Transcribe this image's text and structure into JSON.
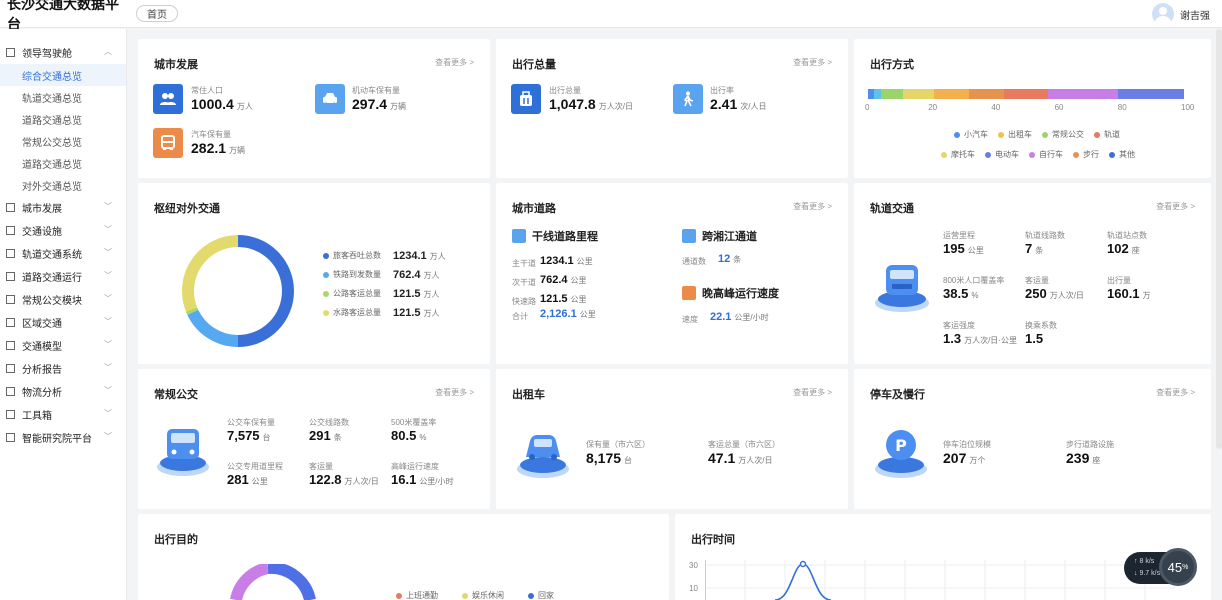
{
  "app": {
    "title": "长沙交通大数据平台",
    "tab": "首页",
    "user": "谢吉强"
  },
  "sidebar": {
    "groups": [
      {
        "label": "领导驾驶舱",
        "expanded": true,
        "items": [
          "综合交通总览",
          "轨道交通总览",
          "道路交通总览",
          "常规公交总览",
          "道路交通总览",
          "对外交通总览"
        ]
      },
      {
        "label": "城市发展"
      },
      {
        "label": "交通设施"
      },
      {
        "label": "轨道交通系统"
      },
      {
        "label": "道路交通运行"
      },
      {
        "label": "常规公交模块"
      },
      {
        "label": "区域交通"
      },
      {
        "label": "交通模型"
      },
      {
        "label": "分析报告"
      },
      {
        "label": "物流分析"
      },
      {
        "label": "工具箱"
      },
      {
        "label": "智能研究院平台"
      }
    ],
    "active_item": "综合交通总览"
  },
  "common": {
    "more": "查看更多 >"
  },
  "city": {
    "title": "城市发展",
    "items": [
      {
        "label": "常住人口",
        "value": "1000.4",
        "unit": "万人",
        "icon": "people-icon"
      },
      {
        "label": "机动车保有量",
        "value": "297.4",
        "unit": "万辆",
        "icon": "car-icon"
      },
      {
        "label": "汽车保有量",
        "value": "282.1",
        "unit": "万辆",
        "icon": "bus-icon"
      }
    ]
  },
  "trips": {
    "title": "出行总量",
    "items": [
      {
        "label": "出行总量",
        "value": "1,047.8",
        "unit": "万人次/日",
        "icon": "bag-icon"
      },
      {
        "label": "出行率",
        "value": "2.41",
        "unit": "次/人日",
        "icon": "walk-icon"
      }
    ]
  },
  "mode": {
    "title": "出行方式",
    "ticks": [
      "0",
      "20",
      "40",
      "60",
      "80",
      "100"
    ],
    "legend_row1": [
      {
        "label": "小汽车",
        "color": "#4f8df2"
      },
      {
        "label": "出租车",
        "color": "#f2c14f"
      },
      {
        "label": "常规公交",
        "color": "#9bd46b"
      },
      {
        "label": "轨道",
        "color": "#e87a5d"
      }
    ],
    "legend_row2": [
      {
        "label": "摩托车",
        "color": "#e6d66a"
      },
      {
        "label": "电动车",
        "color": "#6a7fe6"
      },
      {
        "label": "自行车",
        "color": "#c77ee6"
      },
      {
        "label": "步行",
        "color": "#e6934f"
      },
      {
        "label": "其他",
        "color": "#3b6fd8"
      }
    ],
    "segments": [
      {
        "value": 2,
        "color": "#4f8df2"
      },
      {
        "value": 2,
        "color": "#5ec2e8"
      },
      {
        "value": 7,
        "color": "#9bd46b"
      },
      {
        "value": 10,
        "color": "#e6d66a"
      },
      {
        "value": 11,
        "color": "#f2b04f"
      },
      {
        "value": 11,
        "color": "#e6934f"
      },
      {
        "value": 14,
        "color": "#e87a5d"
      },
      {
        "value": 22,
        "color": "#c77ee6"
      },
      {
        "value": 21,
        "color": "#6a7fe6"
      }
    ]
  },
  "hub": {
    "title": "枢纽对外交通",
    "items": [
      {
        "label": "旅客吞吐总数",
        "value": "1234.1",
        "unit": "万人",
        "color": "#3b6fd8",
        "share": 0.5
      },
      {
        "label": "铁路到发数量",
        "value": "762.4",
        "unit": "万人",
        "color": "#56a8f0",
        "share": 0.18
      },
      {
        "label": "公路客运总量",
        "value": "121.5",
        "unit": "万人",
        "color": "#a9d86a",
        "share": 0.01
      },
      {
        "label": "水路客运总量",
        "value": "121.5",
        "unit": "万人",
        "color": "#e3da6e",
        "share": 0.31
      }
    ]
  },
  "road": {
    "title": "城市道路",
    "mileage": {
      "title": "干线道路里程",
      "rows": [
        {
          "label": "主干道",
          "value": "1234.1",
          "unit": "公里"
        },
        {
          "label": "次干道",
          "value": "762.4",
          "unit": "公里"
        },
        {
          "label": "快速路",
          "value": "121.5",
          "unit": "公里"
        }
      ],
      "total_label": "合计",
      "total_value": "2,126.1",
      "total_unit": "公里"
    },
    "river": {
      "title": "跨湘江通道",
      "label": "通道数",
      "value": "12",
      "unit": "条"
    },
    "peak": {
      "title": "晚高峰运行速度",
      "label": "速度",
      "value": "22.1",
      "unit": "公里/小时"
    }
  },
  "rail": {
    "title": "轨道交通",
    "items": [
      {
        "label": "运营里程",
        "value": "195",
        "unit": "公里"
      },
      {
        "label": "轨道线路数",
        "value": "7",
        "unit": "条"
      },
      {
        "label": "轨道站点数",
        "value": "102",
        "unit": "座"
      },
      {
        "label": "800米人口覆盖率",
        "value": "38.5",
        "unit": "%"
      },
      {
        "label": "客运量",
        "value": "250",
        "unit": "万人次/日"
      },
      {
        "label": "出行量",
        "value": "160.1",
        "unit": "万"
      },
      {
        "label": "客运强度",
        "value": "1.3",
        "unit": "万人次/日·公里"
      },
      {
        "label": "换乘系数",
        "value": "1.5",
        "unit": ""
      }
    ]
  },
  "bus": {
    "title": "常规公交",
    "items": [
      {
        "label": "公交车保有量",
        "value": "7,575",
        "unit": "台"
      },
      {
        "label": "公交线路数",
        "value": "291",
        "unit": "条"
      },
      {
        "label": "500米覆盖率",
        "value": "80.5",
        "unit": "%"
      },
      {
        "label": "公交专用道里程",
        "value": "281",
        "unit": "公里"
      },
      {
        "label": "客运量",
        "value": "122.8",
        "unit": "万人次/日"
      },
      {
        "label": "高峰运行速度",
        "value": "16.1",
        "unit": "公里/小时"
      }
    ]
  },
  "taxi": {
    "title": "出租车",
    "items": [
      {
        "label": "保有量（市六区）",
        "value": "8,175",
        "unit": "台"
      },
      {
        "label": "客运总量（市六区）",
        "value": "47.1",
        "unit": "万人次/日"
      }
    ]
  },
  "parking": {
    "title": "停车及慢行",
    "items": [
      {
        "label": "停车泊位规模",
        "value": "207",
        "unit": "万个"
      },
      {
        "label": "步行道路设施",
        "value": "239",
        "unit": "座"
      }
    ]
  },
  "purpose": {
    "title": "出行目的",
    "legend": [
      {
        "label": "上班通勤",
        "color": "#e87a5d"
      },
      {
        "label": "娱乐休闲",
        "color": "#e6d66a"
      },
      {
        "label": "回家",
        "color": "#3b6fd8"
      }
    ]
  },
  "time": {
    "title": "出行时间",
    "chart_data": {
      "type": "line",
      "yticks": [
        "30",
        "10"
      ],
      "ylim": [
        0,
        35
      ],
      "peak_value": 30
    }
  },
  "widget": {
    "up": "8",
    "down": "9.7",
    "unit": "k/s",
    "percent": "45",
    "pct_sign": "%"
  }
}
